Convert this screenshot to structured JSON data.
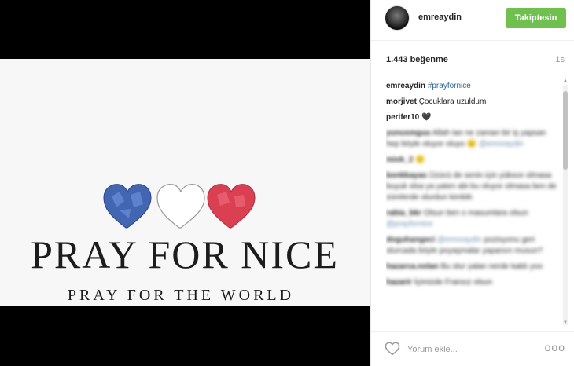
{
  "post": {
    "image": {
      "title": "PRAY FOR NICE",
      "subtitle": "PRAY FOR THE WORLD",
      "heart_colors": [
        "#3a5fb0",
        "#ffffff",
        "#d9374a"
      ]
    }
  },
  "header": {
    "username": "emreaydin",
    "follow_label": "Takiptesin"
  },
  "stats": {
    "likes": "1.443 beğenme",
    "time": "1s"
  },
  "caption": {
    "user": "emreaydin",
    "hashtag": "#prayfornice"
  },
  "comments": [
    {
      "user": "morjivet",
      "text": "Çocuklara uzuldum"
    },
    {
      "user": "perifer10",
      "text": "🖤"
    },
    {
      "user": "yunusmguu",
      "text": "Allah tan ne zaman bir iş yapsan hep böyle oluyor oluyo 😑",
      "mention": "@emreaydin"
    },
    {
      "user": "miok_2",
      "text": "🙂"
    },
    {
      "user": "bonkkayas",
      "text": "Üzücü de senin için yüksce olmasa buyuk olsa ya yaten abi bu oluyor olmasa ben de zürelerde olurdun kimbilr."
    },
    {
      "user": "rabia_bkr",
      "text": "Olsun ben o masumlara olsun",
      "mention": "@prayfornice"
    },
    {
      "user": "doguhangeci",
      "mention": "@emreaydin",
      "text": "pozisyonu geri olurcada böyle poyaşmalar yaparsın musun?"
    },
    {
      "user": "hazarca.nolan",
      "text": "Bu olur yalan nerde kaldı yoo"
    },
    {
      "user": "hazarir",
      "text": "İçimizde Fransız olsun"
    }
  ],
  "footer": {
    "comment_placeholder": "Yorum ekle...",
    "more_label": "ooo"
  }
}
